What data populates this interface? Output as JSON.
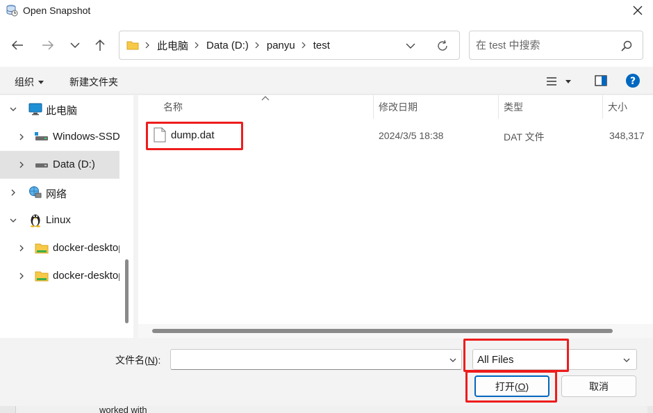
{
  "window": {
    "title": "Open Snapshot",
    "icon": "database-snapshot-icon"
  },
  "navigation": {
    "back_icon": "arrow-left-icon",
    "forward_icon": "arrow-right-icon",
    "recent_icon": "chevron-down-icon",
    "up_icon": "arrow-up-icon",
    "breadcrumb": [
      "此电脑",
      "Data (D:)",
      "panyu",
      "test"
    ],
    "refresh_icon": "refresh-icon"
  },
  "search": {
    "placeholder": "在 test 中搜索",
    "icon": "search-icon"
  },
  "toolbar": {
    "organize_label": "组织",
    "new_folder_label": "新建文件夹",
    "help_icon": "help-icon"
  },
  "sidebar": {
    "items": [
      {
        "label": "此电脑",
        "icon": "computer-icon",
        "expanded": true
      },
      {
        "label": "Windows-SSD",
        "icon": "drive-icon",
        "expanded": false
      },
      {
        "label": "Data (D:)",
        "icon": "drive-icon",
        "expanded": false,
        "selected": true
      },
      {
        "label": "网络",
        "icon": "network-icon",
        "expanded": false
      },
      {
        "label": "Linux",
        "icon": "linux-penguin-icon",
        "expanded": true
      },
      {
        "label": "docker-desktop",
        "icon": "folder-icon",
        "expanded": false
      },
      {
        "label": "docker-desktop-data",
        "icon": "folder-icon",
        "expanded": false
      }
    ]
  },
  "filelist": {
    "columns": [
      "名称",
      "修改日期",
      "类型",
      "大小"
    ],
    "rows": [
      {
        "name": "dump.dat",
        "modified": "2024/3/5 18:38",
        "type": "DAT 文件",
        "size": "348,317"
      }
    ]
  },
  "footer": {
    "filename_label": "文件名(",
    "filename_key": "N",
    "filename_suffix": "):",
    "filename_value": "",
    "filter_value": "All Files",
    "open_label": "打开(",
    "open_key": "O",
    "open_suffix": ")",
    "cancel_label": "取消"
  },
  "background_text": "worked with",
  "colors": {
    "accent": "#0067c0",
    "highlight": "#ee1c1c",
    "selected_bg": "#e2e2e2"
  }
}
